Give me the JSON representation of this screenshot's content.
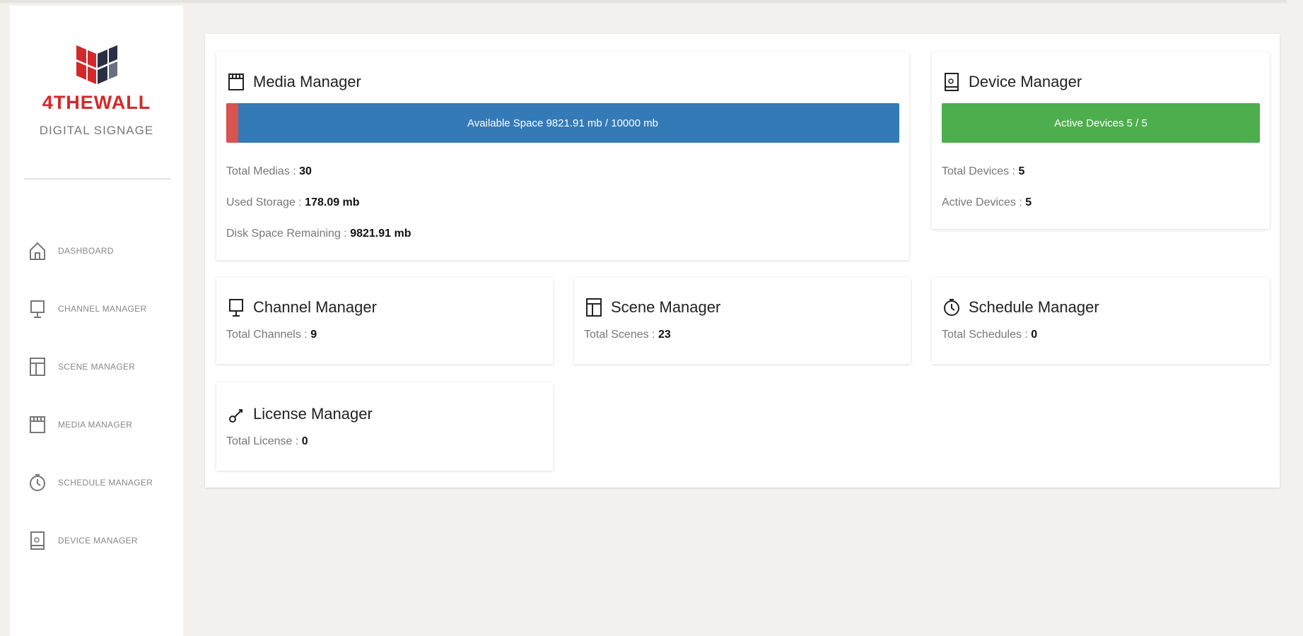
{
  "brand": {
    "name": "4THEWALL",
    "subtitle": "DIGITAL SIGNAGE"
  },
  "sidebar": {
    "items": [
      {
        "label": "DASHBOARD",
        "icon": "home-icon"
      },
      {
        "label": "CHANNEL MANAGER",
        "icon": "monitor-icon"
      },
      {
        "label": "SCENE MANAGER",
        "icon": "layout-icon"
      },
      {
        "label": "MEDIA MANAGER",
        "icon": "film-icon"
      },
      {
        "label": "SCHEDULE MANAGER",
        "icon": "clock-icon"
      },
      {
        "label": "DEVICE MANAGER",
        "icon": "tablet-icon"
      }
    ]
  },
  "cards": {
    "media": {
      "title": "Media Manager",
      "bar_text": "Available Space 9821.91 mb / 10000 mb",
      "used_fraction": 0.0178,
      "total_medias_label": "Total Medias : ",
      "total_medias": "30",
      "used_storage_label": "Used Storage : ",
      "used_storage": "178.09 mb",
      "disk_remaining_label": "Disk Space Remaining : ",
      "disk_remaining": "9821.91 mb"
    },
    "device": {
      "title": "Device Manager",
      "bar_text": "Active Devices 5 / 5",
      "active_fraction": 1.0,
      "total_devices_label": "Total Devices : ",
      "total_devices": "5",
      "active_devices_label": "Active Devices : ",
      "active_devices": "5"
    },
    "channel": {
      "title": "Channel Manager",
      "label": "Total Channels : ",
      "value": "9"
    },
    "scene": {
      "title": "Scene Manager",
      "label": "Total Scenes : ",
      "value": "23"
    },
    "schedule": {
      "title": "Schedule Manager",
      "label": "Total Schedules : ",
      "value": "0"
    },
    "license": {
      "title": "License Manager",
      "label": "Total License : ",
      "value": "0"
    }
  },
  "colors": {
    "brand_red": "#d4282a",
    "bar_blue": "#337ab7",
    "bar_used_red": "#d9534f",
    "bar_green": "#4cae4c"
  }
}
